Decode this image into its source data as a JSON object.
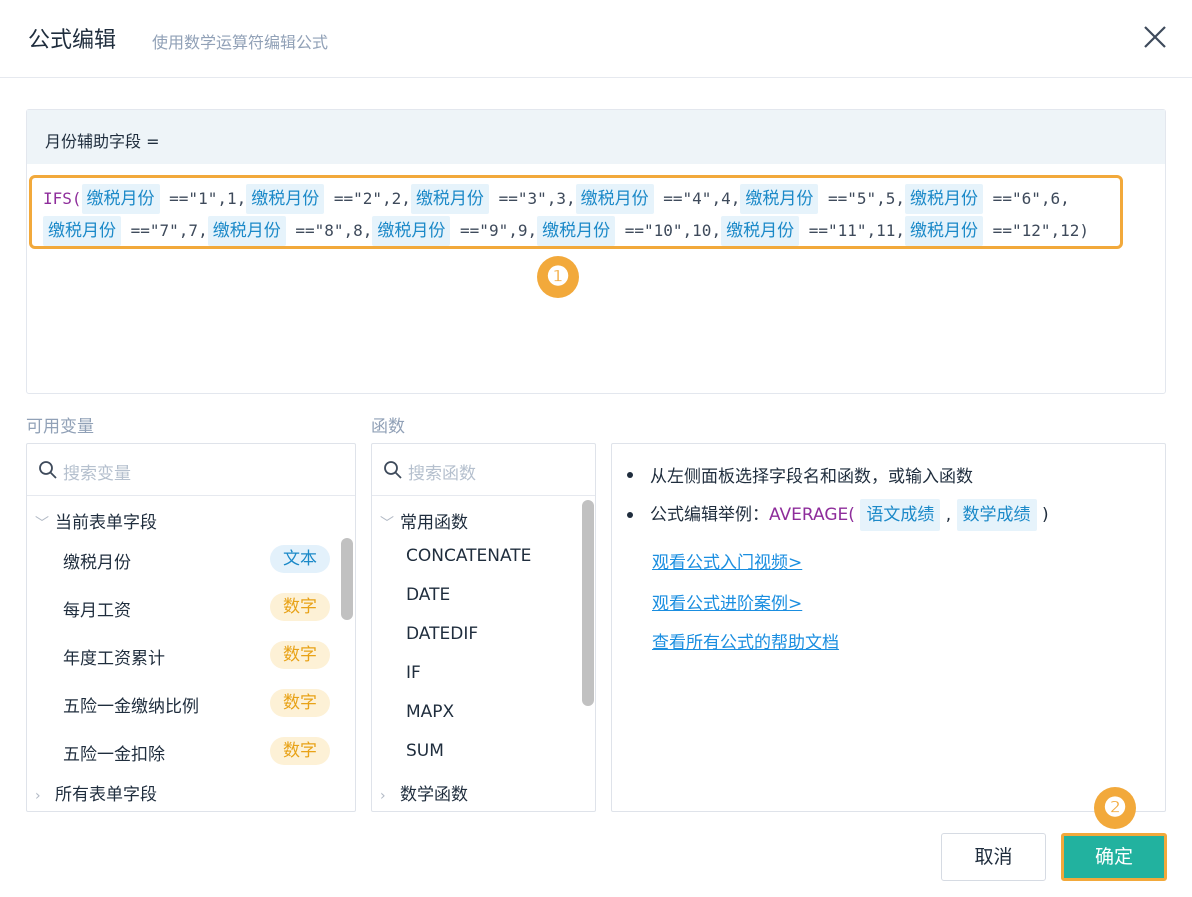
{
  "dialog": {
    "title": "公式编辑",
    "subtitle": "使用数学运算符编辑公式",
    "close_icon": "close-icon"
  },
  "editor": {
    "field_label": "月份辅助字段 =",
    "formula": {
      "func": "IFS(",
      "field_token": "缴税月份",
      "clauses_line1": [
        {
          "cond": "==\"1\",1,"
        },
        {
          "cond": "==\"2\",2,"
        },
        {
          "cond": "==\"3\",3,"
        },
        {
          "cond": "==\"4\",4,"
        },
        {
          "cond": "==\"5\",5,"
        },
        {
          "cond": "==\"6\",6,"
        }
      ],
      "clauses_line2": [
        {
          "cond": "==\"7\",7,"
        },
        {
          "cond": "==\"8\",8,"
        },
        {
          "cond": "==\"9\",9,"
        },
        {
          "cond": "==\"10\",10,"
        },
        {
          "cond": "==\"11\",11,"
        },
        {
          "cond": "==\"12\",12)"
        }
      ]
    },
    "badge_1": "❶"
  },
  "variables": {
    "label": "可用变量",
    "search_placeholder": "搜索变量",
    "group_current": "当前表单字段",
    "items": [
      {
        "name": "缴税月份",
        "type": "文本",
        "kind": "text"
      },
      {
        "name": "每月工资",
        "type": "数字",
        "kind": "num"
      },
      {
        "name": "年度工资累计",
        "type": "数字",
        "kind": "num"
      },
      {
        "name": "五险一金缴纳比例",
        "type": "数字",
        "kind": "num"
      },
      {
        "name": "五险一金扣除",
        "type": "数字",
        "kind": "num"
      }
    ],
    "group_all": "所有表单字段"
  },
  "functions": {
    "label": "函数",
    "search_placeholder": "搜索函数",
    "group_common": "常用函数",
    "items": [
      "CONCATENATE",
      "DATE",
      "DATEDIF",
      "IF",
      "MAPX",
      "SUM"
    ],
    "group_math": "数学函数"
  },
  "help": {
    "line1": "从左侧面板选择字段名和函数，或输入函数",
    "example_prefix": "公式编辑举例：",
    "example_func": "AVERAGE(",
    "example_token1": "语文成绩",
    "example_sep": ",",
    "example_token2": "数学成绩",
    "example_close": ")",
    "links": [
      "观看公式入门视频>",
      "观看公式进阶案例>",
      "查看所有公式的帮助文档"
    ]
  },
  "footer": {
    "cancel_label": "取消",
    "ok_label": "确定",
    "badge_2": "❷"
  },
  "colors": {
    "accent": "#22b29f",
    "highlight": "#f2a93b",
    "token_bg": "#e6f3fb",
    "token_text": "#1b89c8",
    "function_text": "#8e2d9b"
  }
}
